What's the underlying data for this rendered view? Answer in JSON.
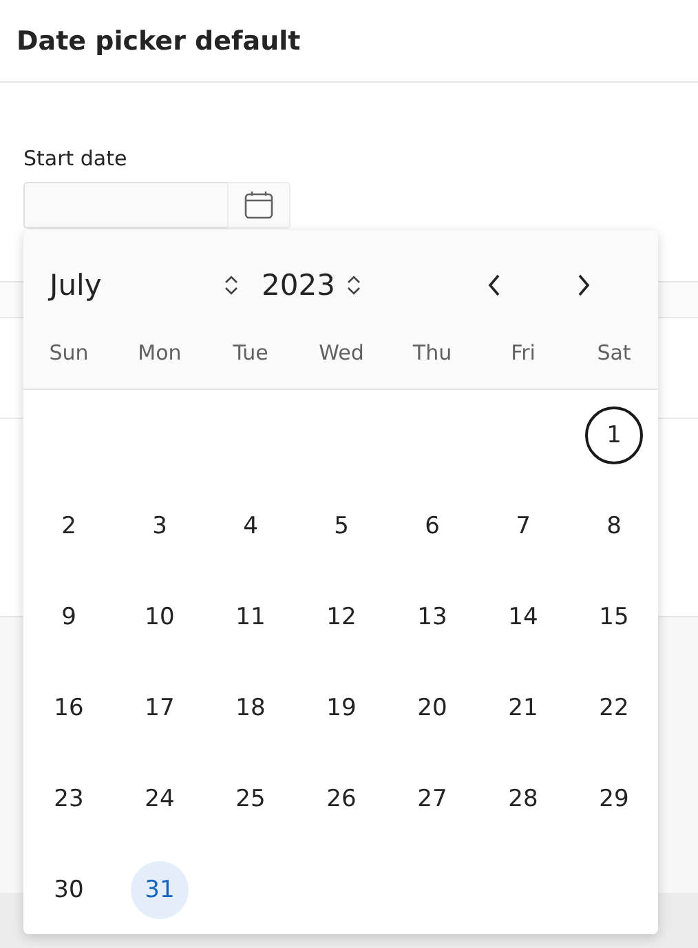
{
  "page": {
    "title": "Date picker default"
  },
  "field": {
    "label": "Start date"
  },
  "calendar": {
    "month": "July",
    "year": "2023",
    "weekdays": [
      "Sun",
      "Mon",
      "Tue",
      "Wed",
      "Thu",
      "Fri",
      "Sat"
    ],
    "weeks": [
      [
        {
          "kind": "blank"
        },
        {
          "kind": "blank"
        },
        {
          "kind": "blank"
        },
        {
          "kind": "blank"
        },
        {
          "kind": "blank"
        },
        {
          "kind": "blank"
        },
        {
          "kind": "day",
          "label": "1",
          "today": true,
          "selected": false
        }
      ],
      [
        {
          "kind": "day",
          "label": "2",
          "today": false,
          "selected": false
        },
        {
          "kind": "day",
          "label": "3",
          "today": false,
          "selected": false
        },
        {
          "kind": "day",
          "label": "4",
          "today": false,
          "selected": false
        },
        {
          "kind": "day",
          "label": "5",
          "today": false,
          "selected": false
        },
        {
          "kind": "day",
          "label": "6",
          "today": false,
          "selected": false
        },
        {
          "kind": "day",
          "label": "7",
          "today": false,
          "selected": false
        },
        {
          "kind": "day",
          "label": "8",
          "today": false,
          "selected": false
        }
      ],
      [
        {
          "kind": "day",
          "label": "9",
          "today": false,
          "selected": false
        },
        {
          "kind": "day",
          "label": "10",
          "today": false,
          "selected": false
        },
        {
          "kind": "day",
          "label": "11",
          "today": false,
          "selected": false
        },
        {
          "kind": "day",
          "label": "12",
          "today": false,
          "selected": false
        },
        {
          "kind": "day",
          "label": "13",
          "today": false,
          "selected": false
        },
        {
          "kind": "day",
          "label": "14",
          "today": false,
          "selected": false
        },
        {
          "kind": "day",
          "label": "15",
          "today": false,
          "selected": false
        }
      ],
      [
        {
          "kind": "day",
          "label": "16",
          "today": false,
          "selected": false
        },
        {
          "kind": "day",
          "label": "17",
          "today": false,
          "selected": false
        },
        {
          "kind": "day",
          "label": "18",
          "today": false,
          "selected": false
        },
        {
          "kind": "day",
          "label": "19",
          "today": false,
          "selected": false
        },
        {
          "kind": "day",
          "label": "20",
          "today": false,
          "selected": false
        },
        {
          "kind": "day",
          "label": "21",
          "today": false,
          "selected": false
        },
        {
          "kind": "day",
          "label": "22",
          "today": false,
          "selected": false
        }
      ],
      [
        {
          "kind": "day",
          "label": "23",
          "today": false,
          "selected": false
        },
        {
          "kind": "day",
          "label": "24",
          "today": false,
          "selected": false
        },
        {
          "kind": "day",
          "label": "25",
          "today": false,
          "selected": false
        },
        {
          "kind": "day",
          "label": "26",
          "today": false,
          "selected": false
        },
        {
          "kind": "day",
          "label": "27",
          "today": false,
          "selected": false
        },
        {
          "kind": "day",
          "label": "28",
          "today": false,
          "selected": false
        },
        {
          "kind": "day",
          "label": "29",
          "today": false,
          "selected": false
        }
      ],
      [
        {
          "kind": "day",
          "label": "30",
          "today": false,
          "selected": false
        },
        {
          "kind": "day",
          "label": "31",
          "today": false,
          "selected": true
        },
        {
          "kind": "blank"
        },
        {
          "kind": "blank"
        },
        {
          "kind": "blank"
        },
        {
          "kind": "blank"
        },
        {
          "kind": "blank"
        }
      ]
    ]
  }
}
